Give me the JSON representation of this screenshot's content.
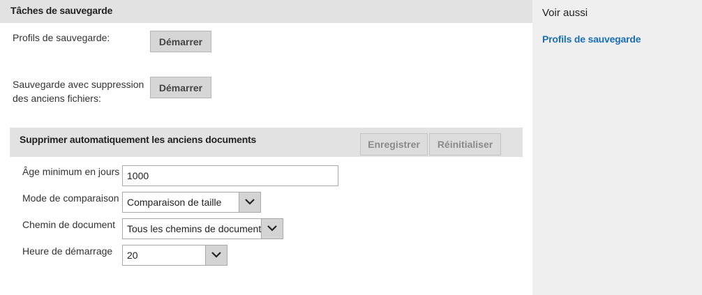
{
  "main": {
    "section_title": "Tâches de sauvegarde",
    "profiles": {
      "label": "Profils de sauvegarde:",
      "button": "Démarrer"
    },
    "cleanup": {
      "label_line1": "Sauvegarde avec suppression",
      "label_line2": "des anciens fichiers:",
      "button": "Démarrer"
    },
    "auto_delete": {
      "title": "Supprimer automatiquement les anciens documents",
      "save_button": "Enregistrer",
      "reset_button": "Réinitialiser",
      "fields": {
        "min_age": {
          "label": "Âge minimum en jours",
          "value": "1000"
        },
        "compare_mode": {
          "label": "Mode de comparaison",
          "value": "Comparaison de taille"
        },
        "doc_path": {
          "label": "Chemin de document",
          "value": "Tous les chemins de document"
        },
        "start_hour": {
          "label": "Heure de démarrage",
          "value": "20"
        }
      }
    }
  },
  "sidebar": {
    "title": "Voir aussi",
    "link": "Profils de sauvegarde"
  },
  "icons": {
    "dropdown": "chevron-down-icon"
  }
}
